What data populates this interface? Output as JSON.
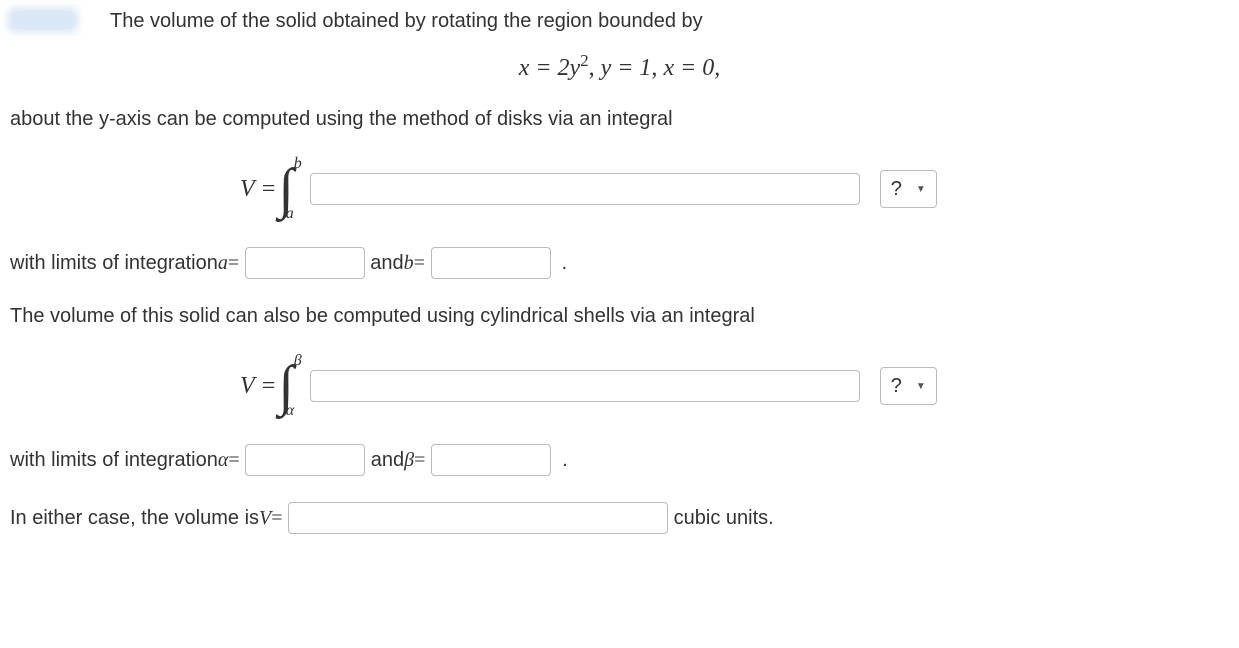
{
  "intro": {
    "line1": "The volume of the solid obtained by rotating the region bounded by",
    "line2": "about the y-axis can be computed using the method of disks via an integral"
  },
  "equation": {
    "x_eq": "x = 2y",
    "x_exp": "2",
    "sep1": ",  ",
    "y_eq": "y = 1,  ",
    "x0": "x = 0,"
  },
  "integral1": {
    "V_eq": "V = ",
    "upper": "b",
    "lower": "a",
    "unit_placeholder": "?"
  },
  "limits1": {
    "prefix": "with limits of integration ",
    "a_sym": "a",
    "eq": " = ",
    "and": " and ",
    "b_sym": "b",
    "period": "."
  },
  "shells_intro": "The volume of this solid can also be computed using cylindrical shells via an integral",
  "integral2": {
    "V_eq": "V = ",
    "upper": "β",
    "lower": "α",
    "unit_placeholder": "?"
  },
  "limits2": {
    "prefix": "with limits of integration ",
    "alpha_sym": "α",
    "eq": " = ",
    "and": " and ",
    "beta_sym": "β",
    "period": "."
  },
  "final": {
    "prefix": "In either case, the volume is ",
    "V_sym": "V",
    "eq": " = ",
    "suffix": " cubic units."
  }
}
